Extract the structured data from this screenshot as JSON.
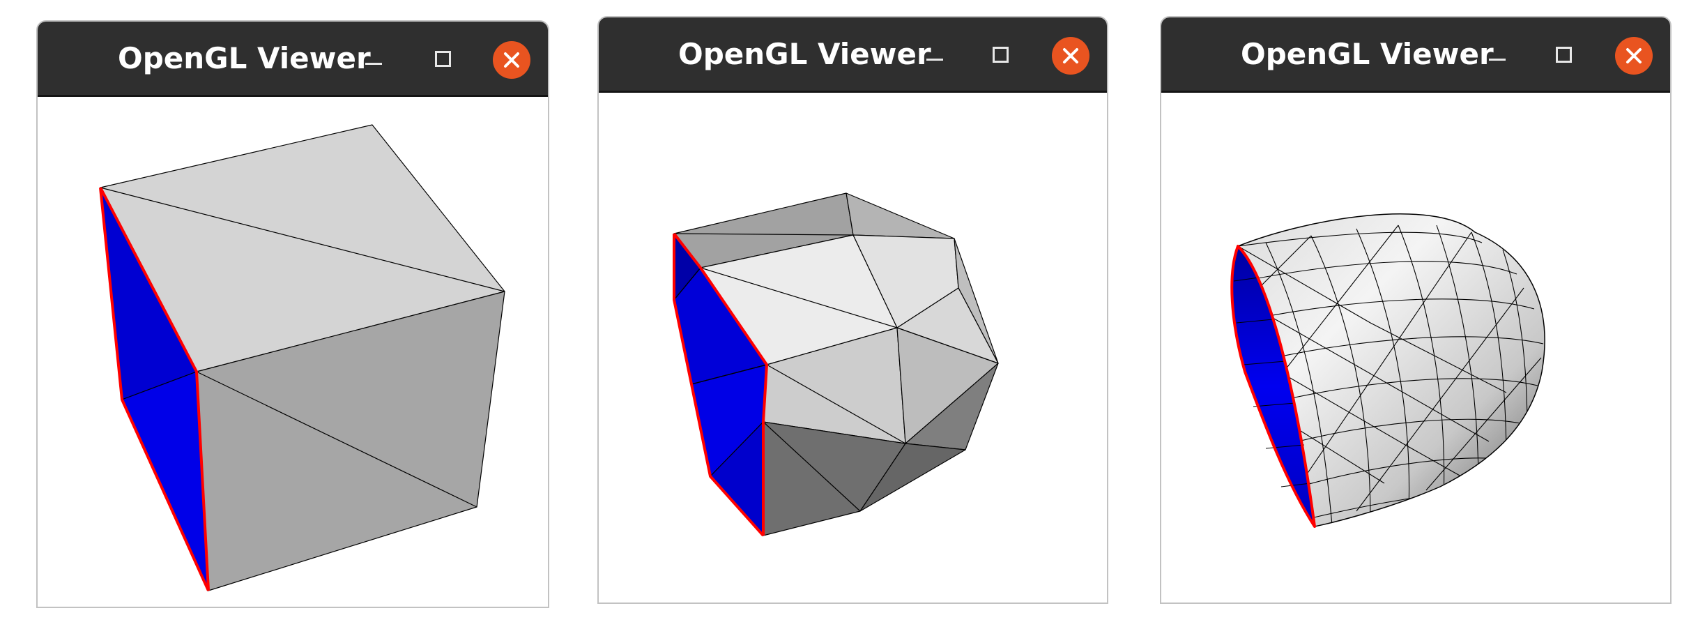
{
  "windows": [
    {
      "title": "OpenGL Viewer",
      "controls": {
        "minimize_icon": "minimize-icon",
        "maximize_icon": "maximize-icon",
        "close_icon": "close-icon"
      },
      "mesh": "coarse-cube"
    },
    {
      "title": "OpenGL Viewer",
      "controls": {
        "minimize_icon": "minimize-icon",
        "maximize_icon": "maximize-icon",
        "close_icon": "close-icon"
      },
      "mesh": "subdivided-once"
    },
    {
      "title": "OpenGL Viewer",
      "controls": {
        "minimize_icon": "minimize-icon",
        "maximize_icon": "maximize-icon",
        "close_icon": "close-icon"
      },
      "mesh": "subdivided-twice"
    }
  ],
  "colors": {
    "titlebar": "#2f2f2f",
    "close_button": "#e95420",
    "boundary_edge": "#ff0000",
    "inner_face": "#0000e6",
    "mesh_edge": "#000000"
  }
}
